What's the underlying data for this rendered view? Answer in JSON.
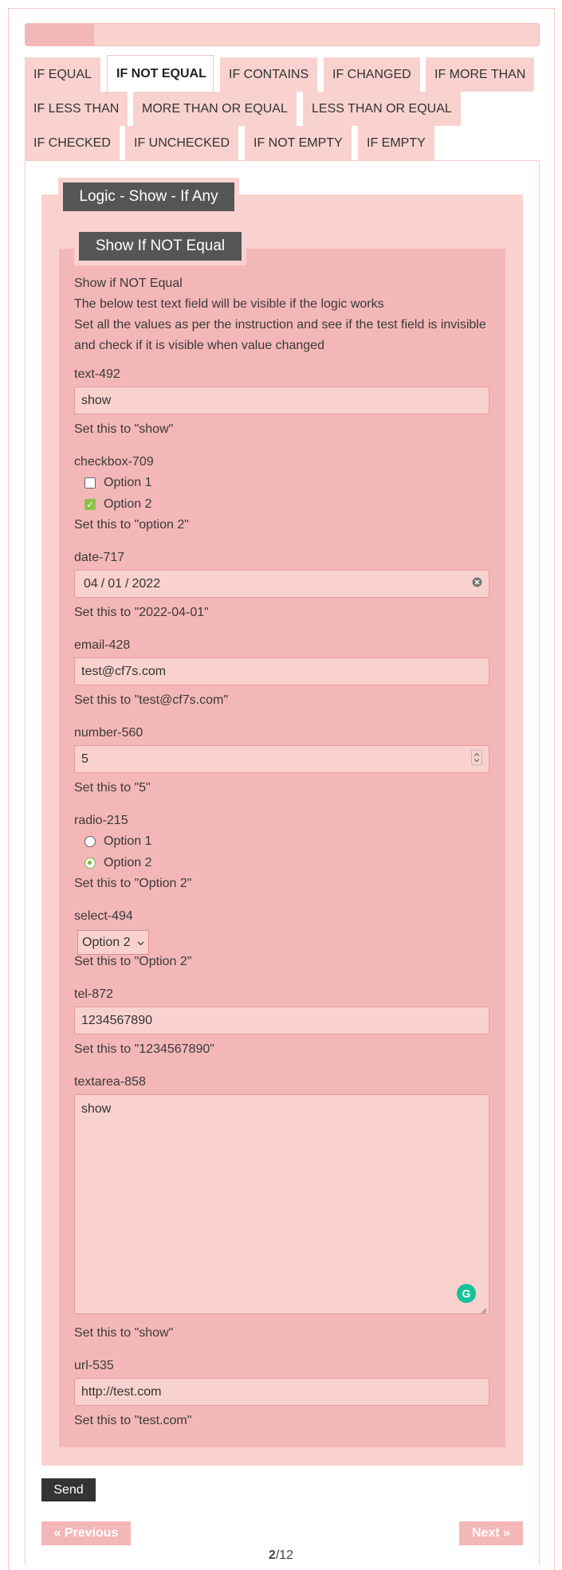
{
  "progress": {
    "fraction": 0.133
  },
  "tabs": [
    "IF EQUAL",
    "IF NOT EQUAL",
    "IF CONTAINS",
    "IF CHANGED",
    "IF MORE THAN",
    "IF LESS THAN",
    "MORE THAN OR EQUAL",
    "LESS THAN OR EQUAL",
    "IF CHECKED",
    "IF UNCHECKED",
    "IF NOT EMPTY",
    "IF EMPTY"
  ],
  "active_tab": "IF NOT EQUAL",
  "group": {
    "legend": "Logic - Show - If Any",
    "sub_legend": "Show If NOT Equal",
    "intro": [
      "Show if NOT Equal",
      "The below test text field will be visible if the logic works",
      "Set all the values as per the instruction and see if the test field is invisible",
      "and check if it is visible when value changed"
    ]
  },
  "fields": {
    "text": {
      "label": "text-492",
      "value": "show",
      "hint": "Set this to \"show\""
    },
    "checkbox": {
      "label": "checkbox-709",
      "options": [
        {
          "label": "Option 1",
          "checked": false
        },
        {
          "label": "Option 2",
          "checked": true
        }
      ],
      "hint": "Set this to \"option 2\""
    },
    "date": {
      "label": "date-717",
      "month": "04",
      "day": "01",
      "year": "2022",
      "hint": "Set this to \"2022-04-01\""
    },
    "email": {
      "label": "email-428",
      "value": "test@cf7s.com",
      "hint": "Set this to \"test@cf7s.com\""
    },
    "number": {
      "label": "number-560",
      "value": "5",
      "hint": "Set this to \"5\""
    },
    "radio": {
      "label": "radio-215",
      "options": [
        {
          "label": "Option 1",
          "checked": false
        },
        {
          "label": "Option 2",
          "checked": true
        }
      ],
      "hint": "Set this to \"Option 2\""
    },
    "select": {
      "label": "select-494",
      "value": "Option 2",
      "hint": "Set this to \"Option 2\""
    },
    "tel": {
      "label": "tel-872",
      "value": "1234567890",
      "hint": "Set this to \"1234567890\""
    },
    "textarea": {
      "label": "textarea-858",
      "value": "show",
      "hint": "Set this to \"show\""
    },
    "url": {
      "label": "url-535",
      "value": "http://test.com",
      "hint": "Set this to \"test.com\""
    }
  },
  "buttons": {
    "send": "Send",
    "previous": "« Previous",
    "next": "Next »"
  },
  "pager": {
    "current": "2",
    "total": "/12"
  },
  "colors": {
    "tab_bg": "#f9d2cf",
    "group_bg": "#f9d2cf",
    "inner_bg": "#f4b7b8",
    "legend_bg": "#555555",
    "accent": "#f4b7b8",
    "check": "#8bc34a"
  },
  "icons": {
    "grammarly": "grammarly-icon",
    "clear": "clear-icon",
    "spinner": "spinner-icon",
    "dropdown": "chevron-down-icon"
  }
}
